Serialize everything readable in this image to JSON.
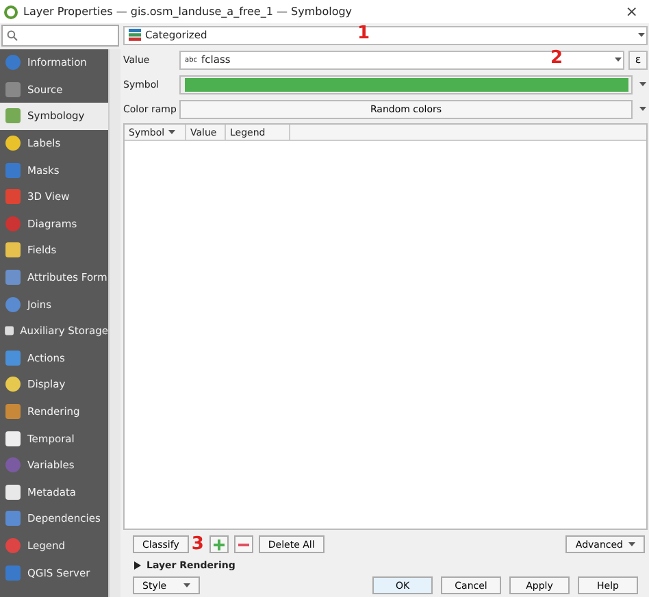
{
  "window": {
    "title": "Layer Properties — gis.osm_landuse_a_free_1 — Symbology",
    "close": "×"
  },
  "sidebar": {
    "items": [
      {
        "label": "Information",
        "selected": false
      },
      {
        "label": "Source",
        "selected": false
      },
      {
        "label": "Symbology",
        "selected": true
      },
      {
        "label": "Labels",
        "selected": false
      },
      {
        "label": "Masks",
        "selected": false
      },
      {
        "label": "3D View",
        "selected": false
      },
      {
        "label": "Diagrams",
        "selected": false
      },
      {
        "label": "Fields",
        "selected": false
      },
      {
        "label": "Attributes Form",
        "selected": false
      },
      {
        "label": "Joins",
        "selected": false
      },
      {
        "label": "Auxiliary Storage",
        "selected": false
      },
      {
        "label": "Actions",
        "selected": false
      },
      {
        "label": "Display",
        "selected": false
      },
      {
        "label": "Rendering",
        "selected": false
      },
      {
        "label": "Temporal",
        "selected": false
      },
      {
        "label": "Variables",
        "selected": false
      },
      {
        "label": "Metadata",
        "selected": false
      },
      {
        "label": "Dependencies",
        "selected": false
      },
      {
        "label": "Legend",
        "selected": false
      },
      {
        "label": "QGIS Server",
        "selected": false
      }
    ]
  },
  "renderer": {
    "value": "Categorized",
    "annotation": "1"
  },
  "value_field": {
    "label": "Value",
    "type_tag": "abc",
    "value": "fclass",
    "annotation": "2",
    "expression": "ε"
  },
  "symbol": {
    "label": "Symbol",
    "color": "#4caf50"
  },
  "color_ramp": {
    "label": "Color ramp",
    "value": "Random colors"
  },
  "table": {
    "columns": [
      "Symbol",
      "Value",
      "Legend"
    ]
  },
  "actions": {
    "classify": "Classify",
    "annotation": "3",
    "delete_all": "Delete All",
    "advanced": "Advanced"
  },
  "layer_rendering": {
    "label": "Layer Rendering",
    "expanded": false
  },
  "footer": {
    "style": "Style",
    "buttons": [
      "OK",
      "Cancel",
      "Apply",
      "Help"
    ]
  }
}
